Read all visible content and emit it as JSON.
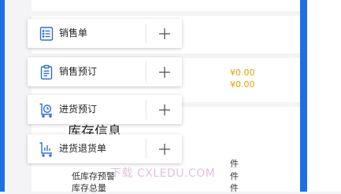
{
  "background": {
    "amount_1": "¥0.00",
    "amount_2": "¥0.00",
    "section_heading": "库存信息",
    "rows": [
      {
        "label": "",
        "unit": "件"
      },
      {
        "label": "低库存预警",
        "unit": "件"
      },
      {
        "label": "库存总量",
        "unit": "件"
      }
    ],
    "watermark": "下载 CXLEDU.COM"
  },
  "menu": {
    "items": [
      {
        "label": "销售单",
        "icon": "list-document-icon",
        "action": "+"
      },
      {
        "label": "销售预订",
        "icon": "clipboard-icon",
        "action": "+"
      },
      {
        "label": "进货预订",
        "icon": "cart-clock-icon",
        "action": "+"
      },
      {
        "label": "进货退货单",
        "icon": "return-chart-icon",
        "action": "+"
      }
    ]
  },
  "colors": {
    "accent": "#1e6fe6",
    "money": "#e0a300",
    "icon": "#2a6fd6"
  }
}
